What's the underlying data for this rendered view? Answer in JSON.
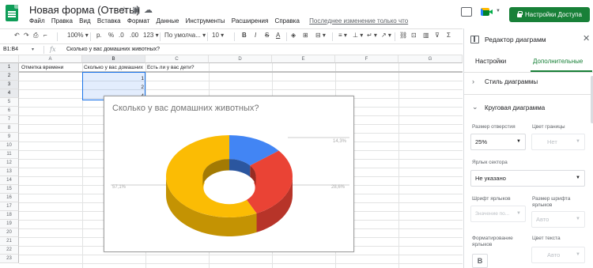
{
  "app": {
    "title": "Новая форма (Ответы)",
    "last_edit": "Последнее изменение только что",
    "share_label": "Настройки Доступа"
  },
  "menu": [
    "Файл",
    "Правка",
    "Вид",
    "Вставка",
    "Формат",
    "Данные",
    "Инструменты",
    "Расширения",
    "Справка"
  ],
  "toolbar": {
    "zoom": "100%",
    "currency": "р.",
    "percent": "%",
    "dec_less": ".0",
    ".dec_more": ".00",
    "dec_more": ".00",
    "num_format": "123",
    "font": "По умолча...",
    "font_size": "10",
    "bold": "B",
    "italic": "I",
    "strike": "S",
    "text_color": "A"
  },
  "formula_bar": {
    "name_box": "B1:B4",
    "fx": "fx",
    "value": "Сколько у вас домашних животных?"
  },
  "sheet": {
    "columns": [
      "A",
      "B",
      "C",
      "D",
      "E",
      "F",
      "G"
    ],
    "rows": [
      "1",
      "2",
      "3",
      "4",
      "5",
      "6",
      "7",
      "8",
      "9",
      "10",
      "11",
      "12",
      "13",
      "14",
      "15",
      "16",
      "17",
      "18",
      "19",
      "20",
      "21",
      "22",
      "23"
    ],
    "cells": {
      "A1": "Отметка времени",
      "B1": "Сколько у вас домашних",
      "C1": "Есть ли у вас дети?",
      "B2": "1",
      "B3": "2",
      "B4": "4"
    }
  },
  "chart": {
    "title": "Сколько у вас домашних животных?",
    "labels": [
      "14,3%",
      "28,6%",
      "57,1%"
    ]
  },
  "chart_data": {
    "type": "pie",
    "title": "Сколько у вас домашних животных?",
    "style": "3d-donut",
    "hole": 0.25,
    "slices": [
      {
        "label": "1",
        "value": 14.3,
        "color": "#4285f4"
      },
      {
        "label": "2",
        "value": 28.6,
        "color": "#ea4335"
      },
      {
        "label": "4",
        "value": 57.1,
        "color": "#fbbc04"
      }
    ],
    "labels_shown": [
      "14,3%",
      "28,6%",
      "57,1%"
    ]
  },
  "panel": {
    "title": "Редактор диаграмм",
    "tabs": [
      "Настройки",
      "Дополнительные"
    ],
    "section_style": "Стиль диаграммы",
    "section_pie": "Круговая диаграмма",
    "hole_label": "Размер отверстия",
    "hole_value": "25%",
    "border_label": "Цвет границы",
    "border_value": "Нет",
    "slice_label_label": "Ярлык сектора",
    "slice_label_value": "Не указано",
    "label_font_label": "Шрифт ярлыков",
    "label_font_value": "Значение по...",
    "label_size_label": "Размер шрифта ярлыков",
    "label_size_value": "Авто",
    "label_format_label": "Форматирование ярлыков",
    "text_color_label": "Цвет текста",
    "text_color_value": "Авто",
    "bold": "B"
  },
  "colors": {
    "brand_green": "#188038",
    "selection": "#1a73e8"
  }
}
